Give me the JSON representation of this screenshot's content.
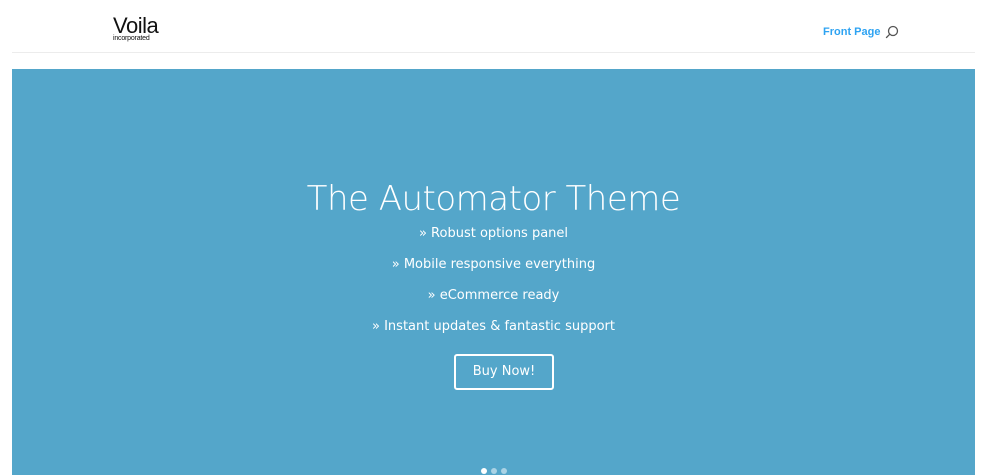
{
  "header": {
    "logo": {
      "name": "Voila",
      "tagline": "incorporated"
    },
    "nav": {
      "items": [
        {
          "label": "Front Page"
        }
      ]
    },
    "search_icon": "search-icon"
  },
  "hero": {
    "title": "The Automator Theme",
    "features": [
      "» Robust options panel",
      "» Mobile responsive everything",
      "» eCommerce ready",
      "» Instant updates & fantastic support"
    ],
    "button_label": "Buy Now!",
    "slides": {
      "count": 3,
      "active_index": 0
    }
  },
  "colors": {
    "accent": "#2ea3f2",
    "hero_background": "#54a6ca",
    "text_on_hero": "#ffffff"
  }
}
